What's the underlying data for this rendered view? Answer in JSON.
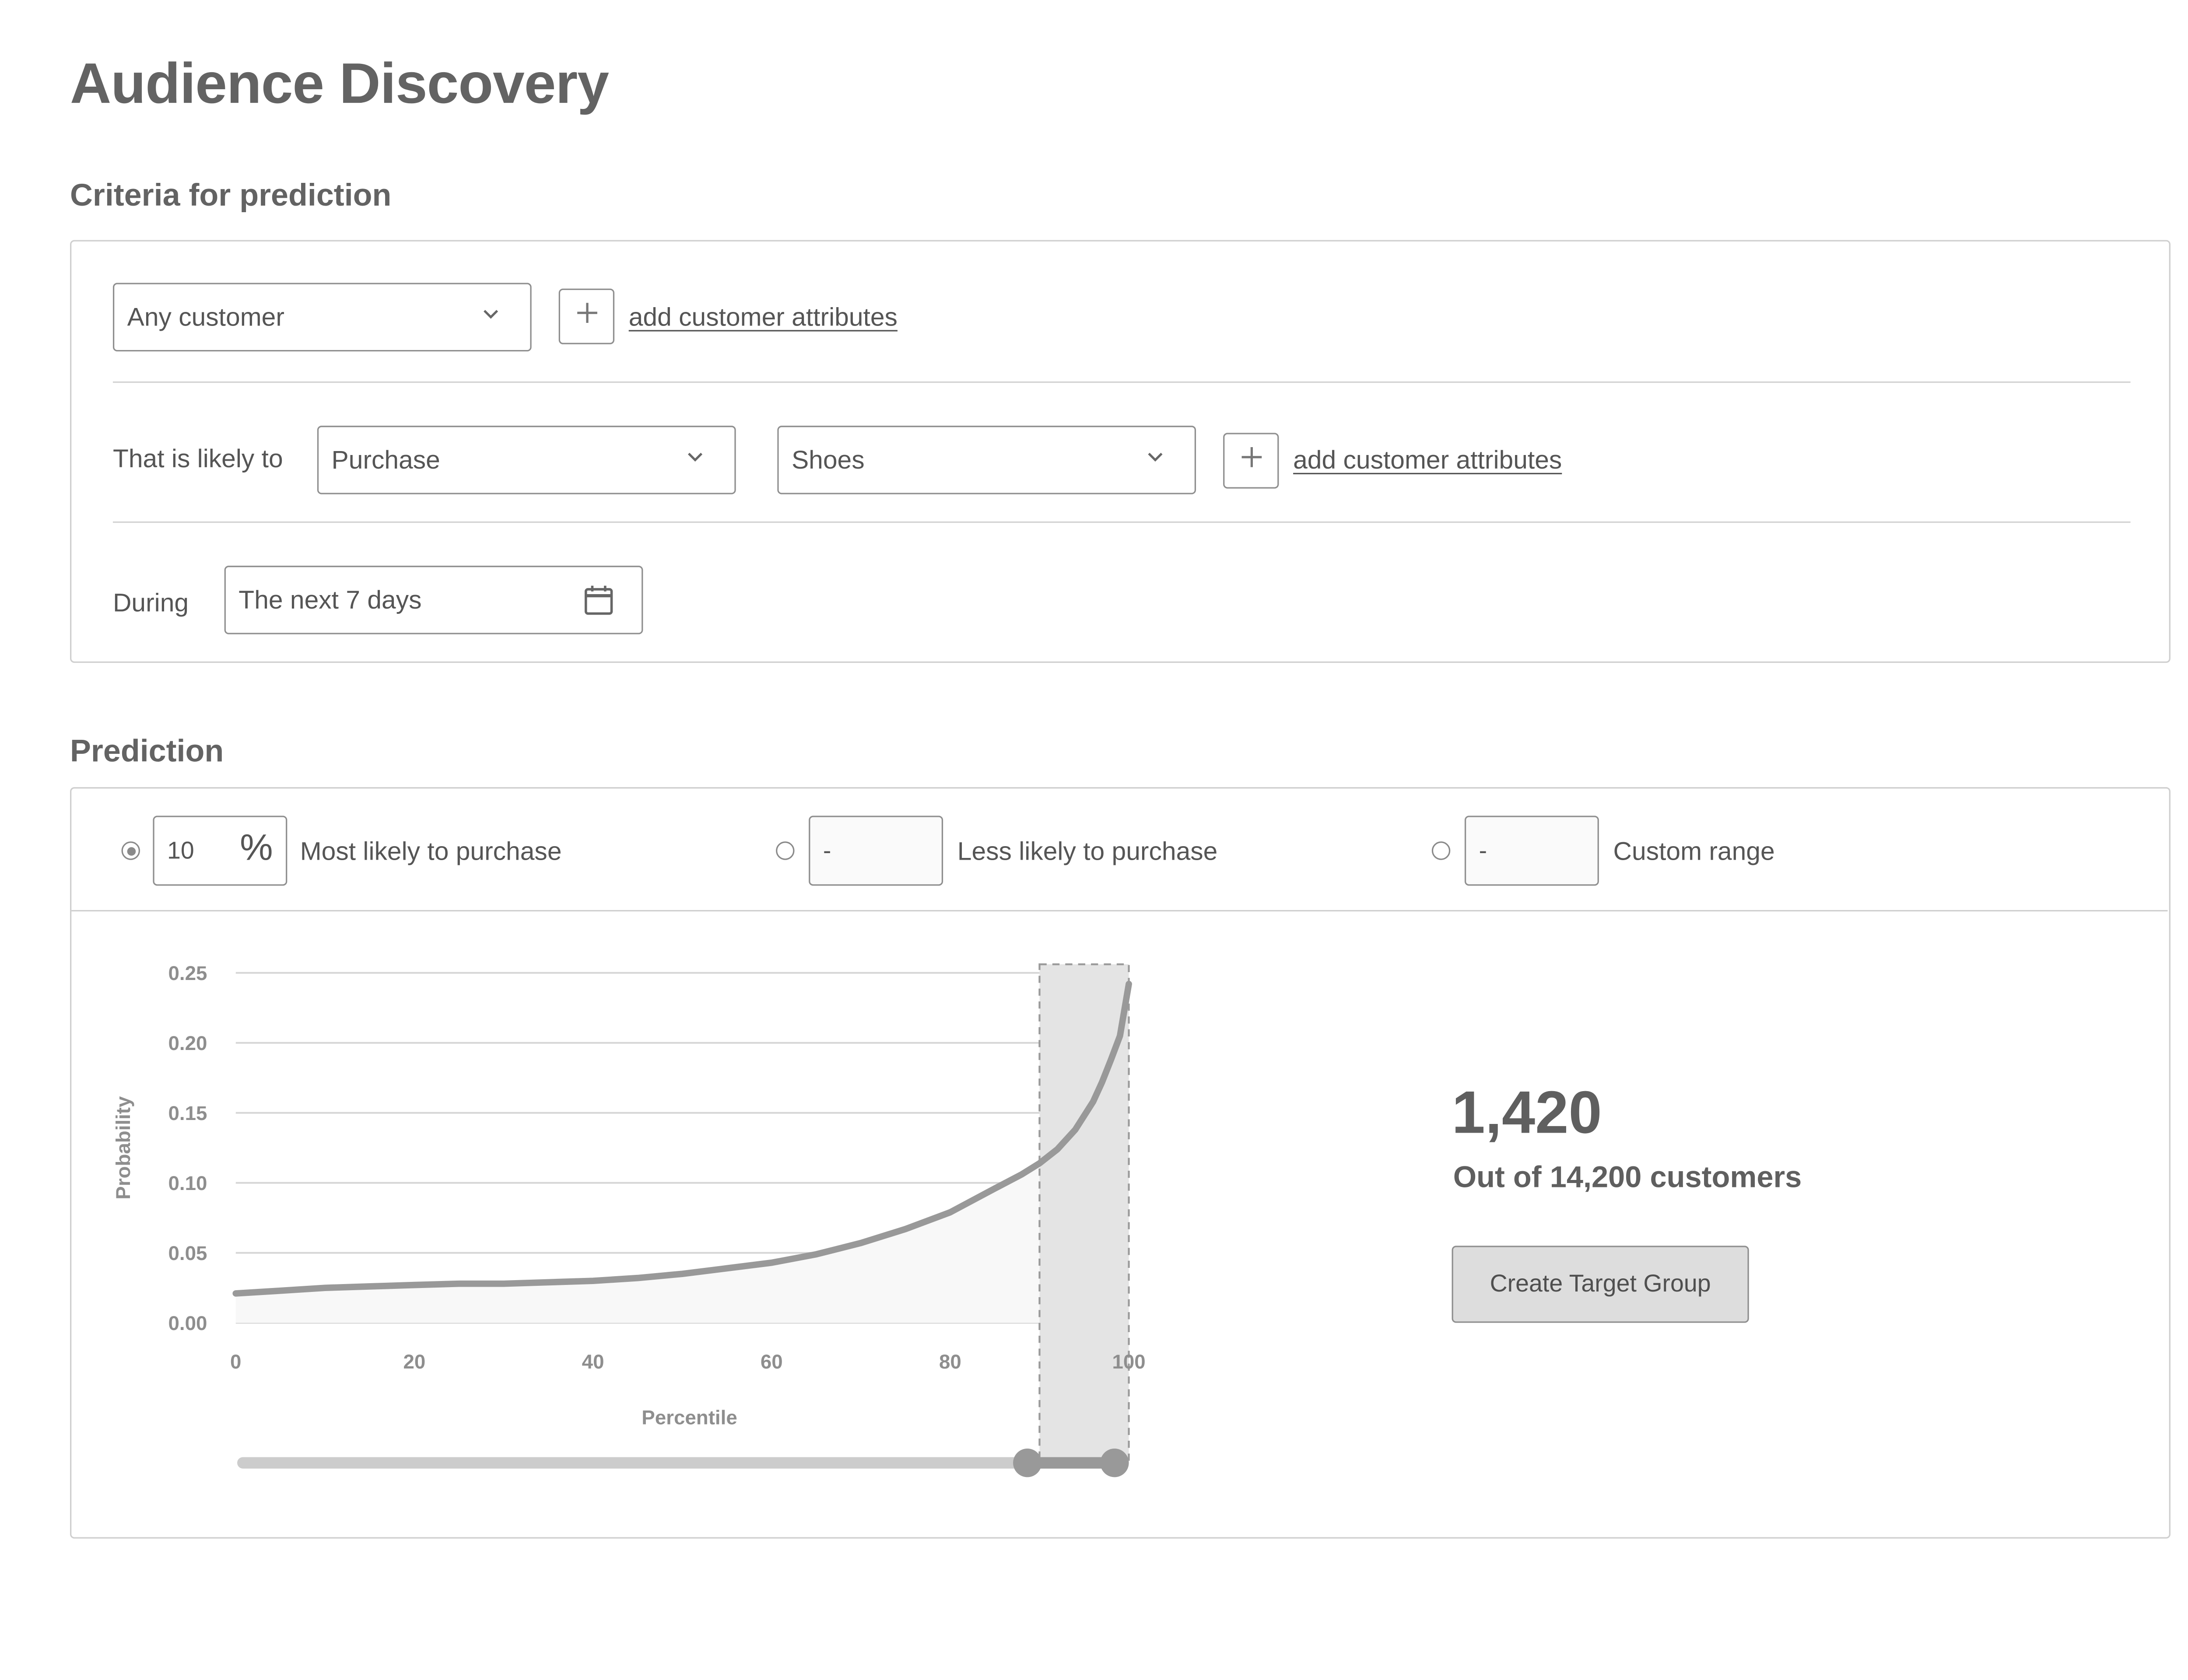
{
  "title": "Audience Discovery",
  "criteria": {
    "heading": "Criteria for prediction",
    "customer_select": "Any customer",
    "add_attributes_1": "add customer attributes",
    "likely_label": "That is likely to",
    "action_select": "Purchase",
    "product_select": "Shoes",
    "add_attributes_2": "add customer attributes",
    "during_label": "During",
    "date_field": "The next 7 days"
  },
  "prediction": {
    "heading": "Prediction",
    "option1": {
      "value": "10",
      "unit": "%",
      "label": "Most likely to purchase",
      "selected": true
    },
    "option2": {
      "value": "-",
      "label": "Less likely to purchase",
      "selected": false
    },
    "option3": {
      "value": "-",
      "label": "Custom range",
      "selected": false
    },
    "count": "1,420",
    "total_text": "Out of 14,200 customers",
    "cta_label": "Create Target Group"
  },
  "icons": {
    "chevron": "chevron-down-icon",
    "plus": "plus-icon",
    "calendar": "calendar-icon"
  },
  "colors": {
    "curve": "#999999",
    "selection": "#e4e4e4",
    "slider_track": "#cccccc",
    "slider_active": "#999999"
  },
  "chart_data": {
    "type": "area",
    "xlabel": "Percentile",
    "ylabel": "Probability",
    "xlim": [
      0,
      100
    ],
    "ylim": [
      0,
      0.25
    ],
    "xticks": [
      0,
      20,
      40,
      60,
      80,
      100
    ],
    "yticks": [
      0.0,
      0.05,
      0.1,
      0.15,
      0.2,
      0.25
    ],
    "ytick_labels": [
      "0.00",
      "0.05",
      "0.10",
      "0.15",
      "0.20",
      "0.25"
    ],
    "grid": true,
    "x": [
      0,
      5,
      10,
      15,
      20,
      25,
      30,
      35,
      40,
      45,
      50,
      55,
      60,
      65,
      70,
      75,
      80,
      85,
      88,
      90,
      92,
      94,
      96,
      97,
      98,
      99,
      100
    ],
    "y": [
      0.021,
      0.023,
      0.025,
      0.026,
      0.027,
      0.028,
      0.028,
      0.029,
      0.03,
      0.032,
      0.035,
      0.039,
      0.043,
      0.049,
      0.057,
      0.067,
      0.079,
      0.096,
      0.106,
      0.114,
      0.124,
      0.138,
      0.158,
      0.172,
      0.188,
      0.205,
      0.242
    ],
    "selection": [
      90,
      100
    ],
    "slider_range": [
      90,
      100
    ]
  }
}
